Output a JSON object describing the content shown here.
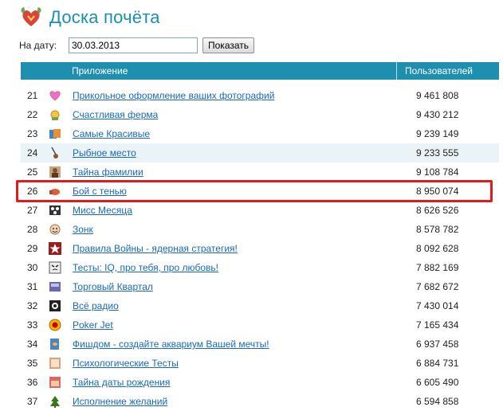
{
  "header": {
    "title": "Доска почёта",
    "logo_icon": "heart-emblem-icon"
  },
  "date_filter": {
    "label": "На дату:",
    "value": "30.03.2013",
    "button_label": "Показать"
  },
  "table": {
    "columns": {
      "app": "Приложение",
      "users": "Пользователей"
    },
    "rows": [
      {
        "rank": "21",
        "icon": "pink-heart-icon",
        "name": "Прикольное оформление ваших фотографий",
        "users": "9 461 808"
      },
      {
        "rank": "22",
        "icon": "farm-sun-icon",
        "name": "Счастливая ферма",
        "users": "9 430 212"
      },
      {
        "rank": "23",
        "icon": "beauty-cards-icon",
        "name": "Самые Красивые",
        "users": "9 239 149"
      },
      {
        "rank": "24",
        "icon": "fishing-rod-icon",
        "name": "Рыбное место",
        "users": "9 233 555"
      },
      {
        "rank": "25",
        "icon": "portrait-icon",
        "name": "Тайна фамилии",
        "users": "9 108 784"
      },
      {
        "rank": "26",
        "icon": "boxing-glove-icon",
        "name": "Бой с тенью",
        "users": "8 950 074"
      },
      {
        "rank": "27",
        "icon": "soccer-ball-icon",
        "name": "Мисс Месяца",
        "users": "8 626 526"
      },
      {
        "rank": "28",
        "icon": "smiley-face-icon",
        "name": "Зонк",
        "users": "8 578 782"
      },
      {
        "rank": "29",
        "icon": "red-star-icon",
        "name": "Правила Войны - ядерная стратегия!",
        "users": "8 092 628"
      },
      {
        "rank": "30",
        "icon": "quiz-mask-icon",
        "name": "Тесты: IQ, про тебя, про любовь!",
        "users": "7 882 169"
      },
      {
        "rank": "31",
        "icon": "market-stall-icon",
        "name": "Торговый Квартал",
        "users": "7 682 672"
      },
      {
        "rank": "32",
        "icon": "radio-icon",
        "name": "Всё радио",
        "users": "7 430 014"
      },
      {
        "rank": "33",
        "icon": "poker-chip-icon",
        "name": "Poker Jet",
        "users": "7 165 434"
      },
      {
        "rank": "34",
        "icon": "aquarium-fish-icon",
        "name": "Фишдом - создайте аквариум Вашей мечты!",
        "users": "6 937 458"
      },
      {
        "rank": "35",
        "icon": "psych-test-icon",
        "name": "Психологические Тесты",
        "users": "6 884 731"
      },
      {
        "rank": "36",
        "icon": "birthday-icon",
        "name": "Тайна даты рождения",
        "users": "6 605 490"
      },
      {
        "rank": "37",
        "icon": "christmas-tree-icon",
        "name": "Исполнение желаний",
        "users": "6 594 858"
      }
    ]
  },
  "colors": {
    "accent": "#1e8fae",
    "title": "#1a8fb0",
    "link": "#1a69b8",
    "highlight": "#e01b1b"
  }
}
